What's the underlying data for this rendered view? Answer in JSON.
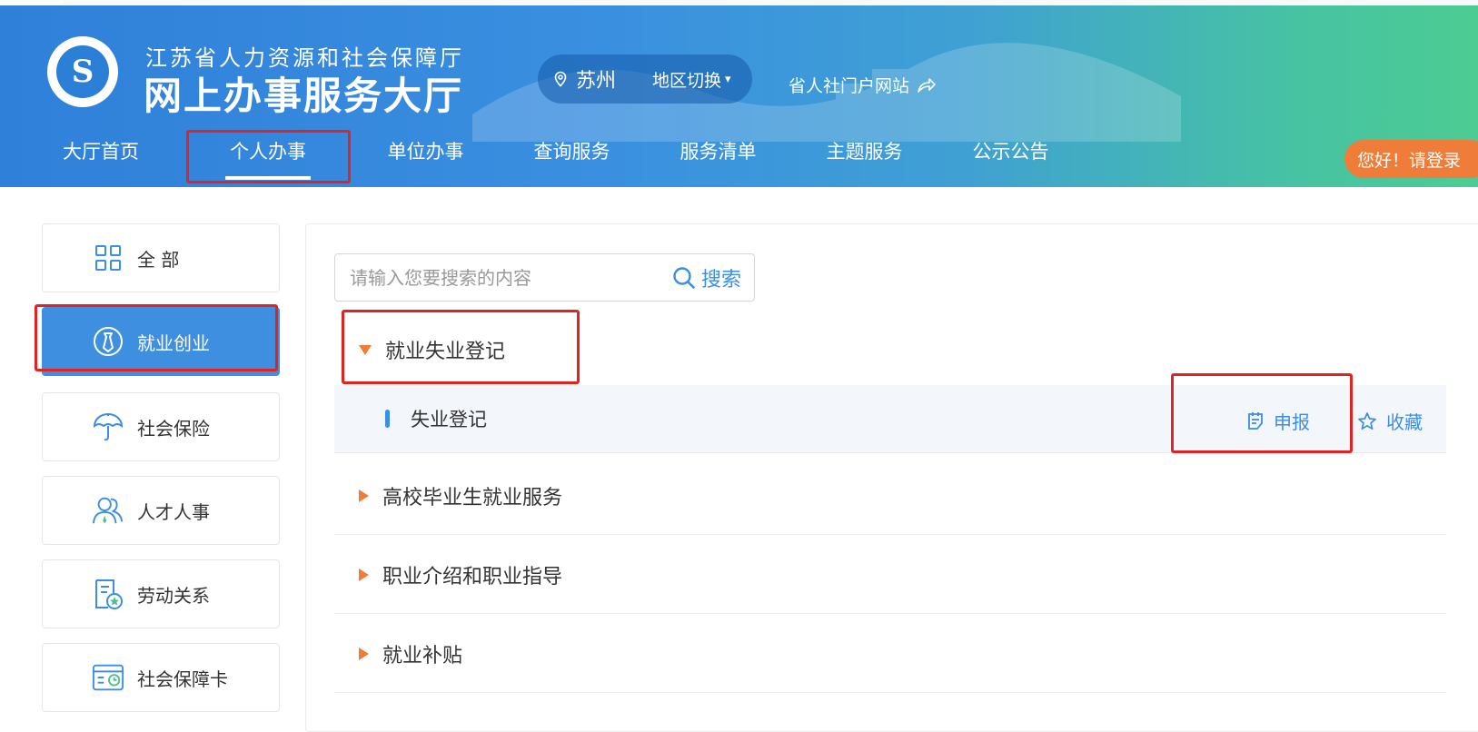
{
  "header": {
    "org_name": "江苏省人力资源和社会保障厅",
    "hall_name": "网上办事服务大厅",
    "logo_glyph": "S",
    "region_city": "苏州",
    "region_switch": "地区切换",
    "caret": "▾",
    "portal_link": "省人社门户网站",
    "login_text": "您好！请登录"
  },
  "nav": {
    "items": [
      "大厅首页",
      "个人办事",
      "单位办事",
      "查询服务",
      "服务清单",
      "主题服务",
      "公示公告"
    ],
    "active": "个人办事"
  },
  "sidebar": {
    "items": [
      {
        "label": "全 部",
        "icon": "grid-icon",
        "active": false
      },
      {
        "label": "就业创业",
        "icon": "tie-icon",
        "active": true
      },
      {
        "label": "社会保险",
        "icon": "umbrella-icon",
        "active": false
      },
      {
        "label": "人才人事",
        "icon": "people-icon",
        "active": false
      },
      {
        "label": "劳动关系",
        "icon": "document-star-icon",
        "active": false
      },
      {
        "label": "社会保障卡",
        "icon": "card-icon",
        "active": false
      }
    ]
  },
  "search": {
    "placeholder": "请输入您要搜索的内容",
    "button": "搜索"
  },
  "categories": [
    {
      "label": "就业失业登记",
      "expanded": true
    },
    {
      "label": "高校毕业生就业服务",
      "expanded": false
    },
    {
      "label": "职业介绍和职业指导",
      "expanded": false
    },
    {
      "label": "就业补贴",
      "expanded": false
    }
  ],
  "subitem": {
    "label": "失业登记",
    "apply": "申报",
    "favorite": "收藏"
  },
  "colors": {
    "brand_blue": "#3f8fe0",
    "accent_orange": "#f07c39",
    "highlight_red": "#e32222",
    "link_blue": "#3a8ee6"
  }
}
